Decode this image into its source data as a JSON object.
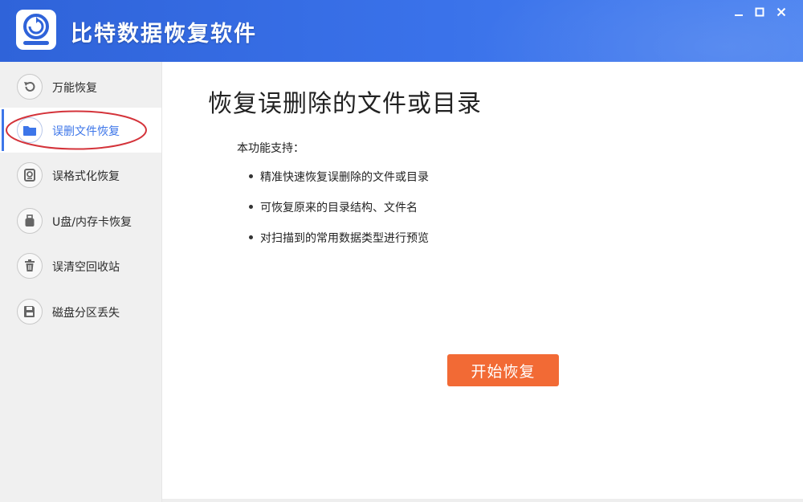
{
  "window": {
    "title": "比特数据恢复软件",
    "controls": [
      "minimize-icon",
      "maximize-icon",
      "close-icon"
    ],
    "colors": {
      "titlebar": "#3a72ea",
      "accent": "#3d76e9",
      "action": "#f26a35",
      "annotation": "#d4333a"
    }
  },
  "sidebar": {
    "items": [
      {
        "label": "万能恢复",
        "icon": "undo-icon",
        "active": false
      },
      {
        "label": "误删文件恢复",
        "icon": "folder-icon",
        "active": true
      },
      {
        "label": "误格式化恢复",
        "icon": "drive-icon",
        "active": false
      },
      {
        "label": "U盘/内存卡恢复",
        "icon": "usb-drive-icon",
        "active": false
      },
      {
        "label": "误清空回收站",
        "icon": "trash-icon",
        "active": false
      },
      {
        "label": "磁盘分区丢失",
        "icon": "disk-partition-icon",
        "active": false
      }
    ]
  },
  "main": {
    "title": "恢复误删除的文件或目录",
    "support_label": "本功能支持：",
    "features": [
      "精准快速恢复误删除的文件或目录",
      "可恢复原来的目录结构、文件名",
      "对扫描到的常用数据类型进行预览"
    ],
    "start_button": "开始恢复"
  }
}
